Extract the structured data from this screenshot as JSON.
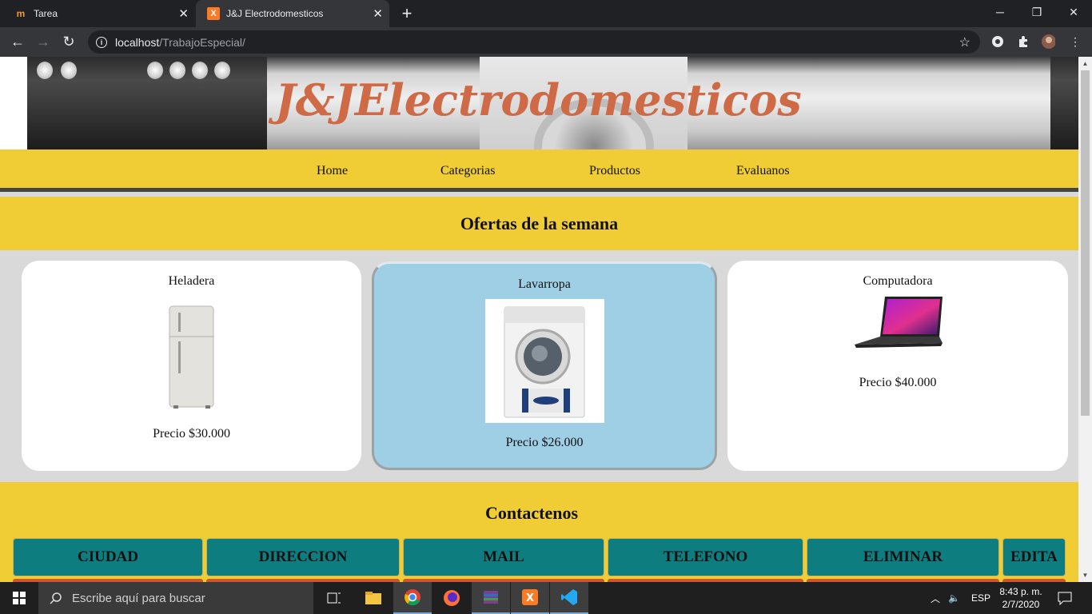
{
  "browser": {
    "tabs": [
      {
        "title": "Tarea",
        "favicon": "tarea-favicon",
        "active": false
      },
      {
        "title": "J&J Electrodomesticos",
        "favicon": "xampp-favicon",
        "active": true
      }
    ],
    "address": {
      "host": "localhost",
      "path": "/TrabajoEspecial/"
    },
    "window_controls": {
      "minimize": "─",
      "restore": "❐",
      "close": "✕"
    }
  },
  "page": {
    "brand": "J&JElectrodomesticos",
    "nav": [
      "Home",
      "Categorias",
      "Productos",
      "Evaluanos"
    ],
    "offers_title": "Ofertas de la semana",
    "products": [
      {
        "name": "Heladera",
        "price": "Precio $30.000",
        "image": "refrigerator-image"
      },
      {
        "name": "Lavarropa",
        "price": "Precio $26.000",
        "image": "washing-machine-image",
        "highlighted": true
      },
      {
        "name": "Computadora",
        "price": "Precio $40.000",
        "image": "laptop-image"
      }
    ],
    "contact_title": "Contactenos",
    "table_headers": [
      "CIUDAD",
      "DIRECCION",
      "MAIL",
      "TELEFONO",
      "ELIMINAR",
      "EDITA"
    ]
  },
  "taskbar": {
    "search_placeholder": "Escribe aquí para buscar",
    "language": "ESP",
    "time": "8:43 p. m.",
    "date": "2/7/2020"
  },
  "colors": {
    "brand_text": "#cf6a46",
    "nav_bg": "#f0cd35",
    "table_header_bg": "#0d7d7f",
    "highlight_card": "#9ecfe4"
  }
}
